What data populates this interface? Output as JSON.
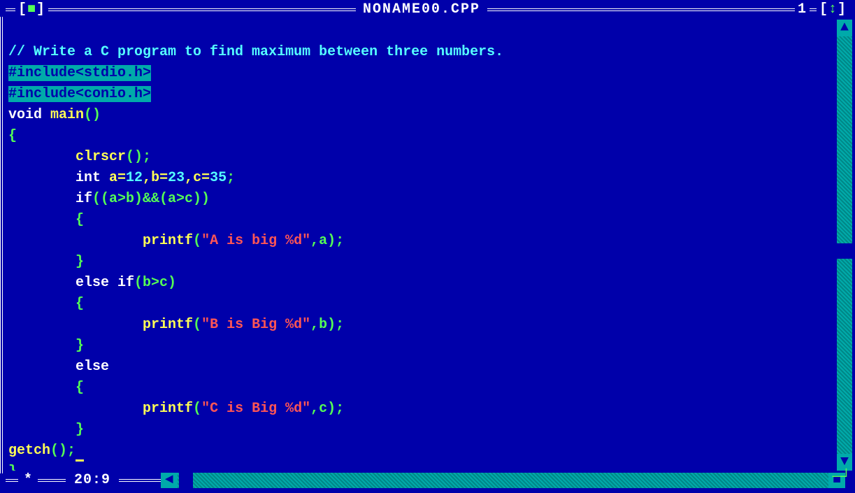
{
  "titlebar": {
    "left_marker_open": "[",
    "left_marker_close": "]",
    "left_symbol": "■",
    "title": "NONAME00.CPP",
    "right_number": "1",
    "right_marker_open": "[",
    "right_marker_close": "]",
    "updown_symbol": "↕"
  },
  "statusbar": {
    "modified_symbol": "*",
    "cursor_pos": "20:9",
    "left_arrow": "◄",
    "right_arrow": "─┘",
    "up_arrow": "▲",
    "down_arrow": "▼",
    "resize": "─┘"
  },
  "code": {
    "l1_comment": "// Write a C program to find maximum between three numbers.",
    "l2_inc1": "#include<stdio.h>",
    "l3_inc2": "#include<conio.h>",
    "l4_void": "void",
    "l4_main": " main",
    "l4_paren": "()",
    "l5_brace": "{",
    "l6_indent": "        ",
    "l6_fn": "clrscr",
    "l6_rest": "();",
    "l7_indent": "        ",
    "l7_int": "int",
    "l7_vars": " a=",
    "l7_n1": "12",
    "l7_c1": ",b=",
    "l7_n2": "23",
    "l7_c2": ",c=",
    "l7_n3": "35",
    "l7_semi": ";",
    "l8_indent": "        ",
    "l8_if": "if",
    "l8_cond": "((a>b)&&(a>c))",
    "l9_indent": "        ",
    "l9_brace": "{",
    "l10_indent": "                ",
    "l10_printf": "printf",
    "l10_open": "(",
    "l10_str": "\"A is big %d\"",
    "l10_rest": ",a);",
    "l11_indent": "        ",
    "l11_brace": "}",
    "l12_indent": "        ",
    "l12_else": "else if",
    "l12_cond": "(b>c)",
    "l13_indent": "        ",
    "l13_brace": "{",
    "l14_indent": "                ",
    "l14_printf": "printf",
    "l14_open": "(",
    "l14_str": "\"B is Big %d\"",
    "l14_rest": ",b);",
    "l15_indent": "        ",
    "l15_brace": "}",
    "l16_indent": "        ",
    "l16_else": "else",
    "l17_indent": "        ",
    "l17_brace": "{",
    "l18_indent": "                ",
    "l18_printf": "printf",
    "l18_open": "(",
    "l18_str": "\"C is Big %d\"",
    "l18_rest": ",c);",
    "l19_indent": "        ",
    "l19_brace": "}",
    "l20_getch": "getch",
    "l20_rest": "();",
    "l21_brace": "}"
  }
}
